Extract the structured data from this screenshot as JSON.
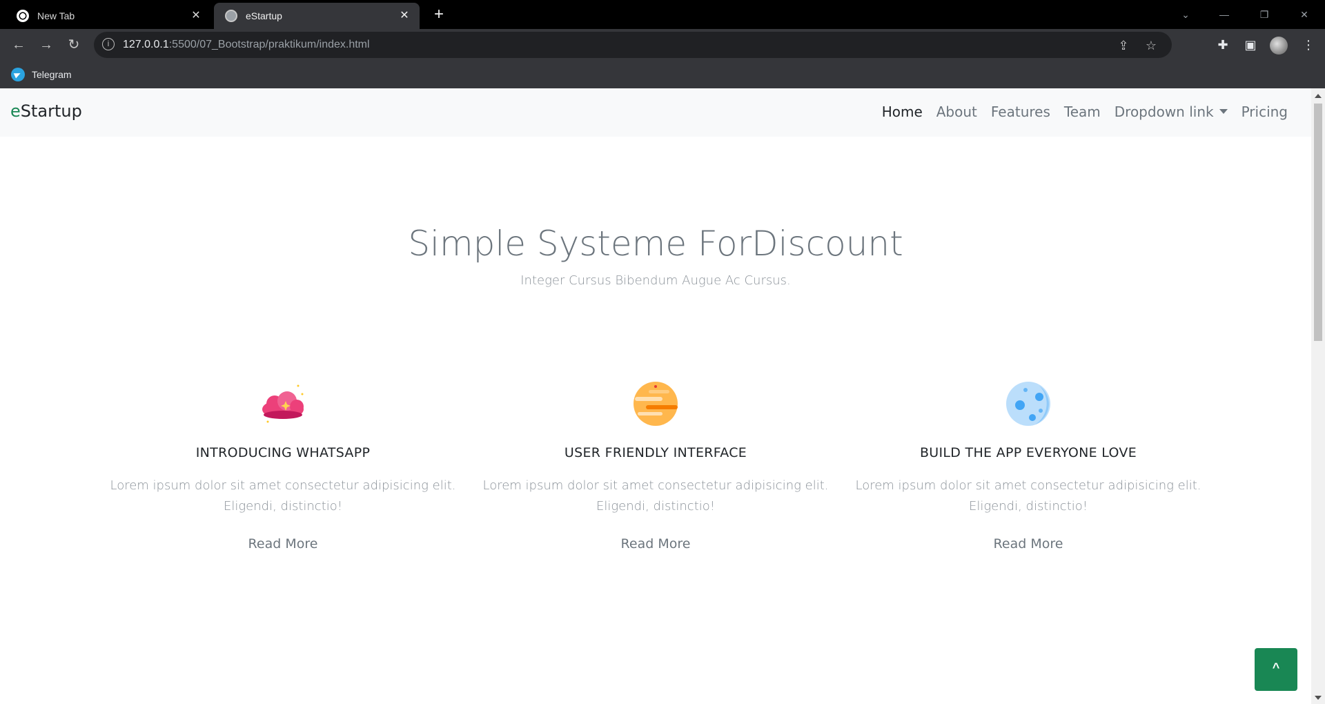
{
  "browser": {
    "tabs": [
      {
        "title": "New Tab",
        "active": false
      },
      {
        "title": "eStartup",
        "active": true
      }
    ],
    "url_host": "127.0.0.1",
    "url_rest": ":5500/07_Bootstrap/praktikum/index.html",
    "bookmarks": [
      {
        "label": "Telegram"
      }
    ]
  },
  "navbar": {
    "brand_first": "e",
    "brand_rest": "Startup",
    "links": [
      {
        "label": "Home",
        "active": true
      },
      {
        "label": "About"
      },
      {
        "label": "Features"
      },
      {
        "label": "Team"
      },
      {
        "label": "Dropdown link"
      },
      {
        "label": "Pricing"
      }
    ]
  },
  "hero": {
    "title": "Simple Systeme ForDiscount",
    "subtitle": "Integer Cursus Bibendum Augue Ac Cursus."
  },
  "features": [
    {
      "icon": "pink-cloud-icon",
      "title": "INTRODUCING WHATSAPP",
      "text_line1": "Lorem ipsum dolor sit amet consectetur adipisicing elit.",
      "text_line2": "Eligendi, distinctio!",
      "link": "Read More"
    },
    {
      "icon": "orange-planet-icon",
      "title": "USER FRIENDLY INTERFACE",
      "text_line1": "Lorem ipsum dolor sit amet consectetur adipisicing elit.",
      "text_line2": "Eligendi, distinctio!",
      "link": "Read More"
    },
    {
      "icon": "blue-moon-icon",
      "title": "BUILD THE APP EVERYONE LOVE",
      "text_line1": "Lorem ipsum dolor sit amet consectetur adipisicing elit.",
      "text_line2": "Eligendi, distinctio!",
      "link": "Read More"
    }
  ],
  "back_to_top": "^",
  "colors": {
    "accent": "#198754",
    "browser_bg": "#35363a",
    "muted_text": "#6c757d"
  }
}
